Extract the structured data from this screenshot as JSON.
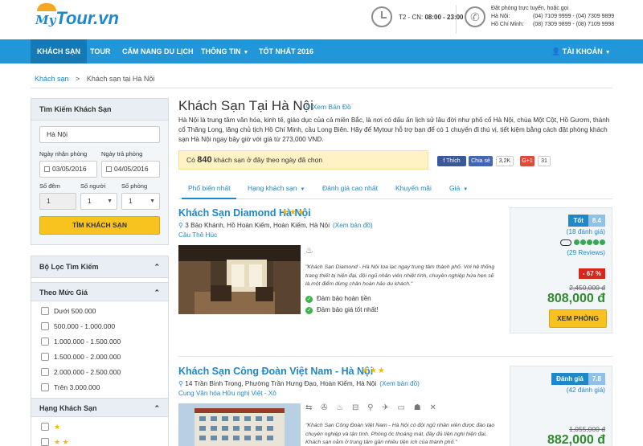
{
  "header": {
    "logo_prefix": "My",
    "logo_main": "Tour.vn",
    "hours_label": "T2 - CN:",
    "hours_value": "08:00 - 23:00",
    "phone_title": "Đặt phòng trực tuyến, hoặc gọi",
    "hanoi_label": "Hà Nội:",
    "hanoi_numbers": "(04) 7109 9999  -  (04) 7309 9899",
    "hcm_label": "Hồ Chí Minh:",
    "hcm_numbers": "(08) 7309 9899  -  (08) 7109 9998"
  },
  "nav": {
    "items": [
      "KHÁCH SẠN",
      "TOUR",
      "CẨM NANG DU LỊCH",
      "THÔNG TIN",
      "TỐT NHẤT 2016"
    ],
    "account": "TÀI KHOẢN"
  },
  "breadcrumb": {
    "root": "Khách sạn",
    "sep": ">",
    "current": "Khách sạn tại Hà Nội"
  },
  "search": {
    "title": "Tìm Kiếm Khách Sạn",
    "destination": "Hà Nội",
    "checkin_label": "Ngày nhận phòng",
    "checkout_label": "Ngày trả phòng",
    "checkin": "03/05/2016",
    "checkout": "04/05/2016",
    "nights_label": "Số đêm",
    "guests_label": "Số người",
    "rooms_label": "Số phòng",
    "nights": "1",
    "guests": "1",
    "rooms": "1",
    "button": "TÌM KHÁCH SẠN"
  },
  "filter": {
    "title": "Bộ Lọc Tìm Kiếm",
    "price_title": "Theo Mức Giá",
    "price_options": [
      "Dưới 500.000",
      "500.000 - 1.000.000",
      "1.000.000 - 1.500.000",
      "1.500.000 - 2.000.000",
      "2.000.000 - 2.500.000",
      "Trên 3.000.000"
    ],
    "class_title": "Hạng Khách Sạn",
    "class_stars": [
      "★",
      "★ ★"
    ]
  },
  "main": {
    "title": "Khách Sạn Tại Hà Nội",
    "map_link": "Xem Bản Đồ",
    "intro": "Hà Nội là trung tâm văn hóa, kinh tế, giáo dục của cả miền Bắc, là nơi có dấu ấn lịch sử lâu đời như phố cổ Hà Nội, chùa Một Cột, Hồ Gươm, thành cổ Thăng Long, lăng chủ tịch Hồ Chí Minh, cầu Long Biên. Hãy để Mytour hỗ trợ bạn để có 1 chuyến đi thú vị, tiết kiệm bằng cách đặt phòng khách sạn Hà Nội ngay bây giờ với giá từ 273,000 VND.",
    "count_prefix": "Có",
    "count": "840",
    "count_suffix": "khách sạn ở đây theo ngày đã chọn",
    "fb_like": "Thích",
    "fb_share": "Chia sẻ",
    "fb_count": "3,2K",
    "gplus": "G+1",
    "gplus_count": "31",
    "tabs": [
      "Phổ biến nhất",
      "Hạng khách sạn",
      "Đánh giá cao nhất",
      "Khuyến mãi",
      "Giá"
    ]
  },
  "hotels": [
    {
      "name": "Khách Sạn Diamond Hà Nội",
      "stars": "★★★",
      "address": "3 Bảo Khánh, Hồ Hoàn Kiếm, Hoàn Kiếm, Hà Nội",
      "map": "(Xem bản đồ)",
      "area": "Cầu Thê Húc",
      "amenities": "♨",
      "description": "\"Khách Sạn Diamond - Hà Nội tọa lạc ngay trung tâm thành phố. Với hệ thống trang thiết bị hiện đại, đội ngũ nhân viên nhiệt tình, chuyên nghiệp hứa hẹn sẽ là một điểm dừng chân hoàn hảo du khách.\"",
      "check1": "Đảm bảo hoàn tiền",
      "check2": "Đảm bảo giá tốt nhất!",
      "rating_word": "Tốt",
      "rating": "8.4",
      "rating_count": "(18 đánh giá)",
      "ta_reviews": "(29 Reviews)",
      "discount": "- 67 %",
      "old_price": "2,450,000 đ",
      "price": "808,000 đ",
      "button": "XEM PHÒNG"
    },
    {
      "name": "Khách Sạn Công Đoàn Việt Nam - Hà Nội",
      "stars": "★★★",
      "address": "14 Trần Bình Trọng, Phường Trần Hưng Đạo, Hoàn Kiếm, Hà Nội",
      "map": "(Xem bản đồ)",
      "area": "Cung Văn hóa Hữu nghị Việt - Xô",
      "amenities": "⇆ ✇ ♨ ⊟ ⚲ ✈ ▭ ☗ ✕",
      "description": "\"Khách Sạn Công Đoàn Việt Nam - Hà Nội có đội ngũ nhân viên được đào tạo chuyên nghiệp và tận tình. Phòng ốc thoáng mát, đầy đủ tiện nghi hiện đại. Khách sạn nằm ở trung tâm gần nhiều tiện ích của thành phố.\"",
      "rating_word": "Đánh giá",
      "rating": "7.8",
      "rating_count": "(42 đánh giá)",
      "old_price": "1,055,000 đ",
      "price": "882,000 đ"
    }
  ],
  "colors": {
    "brand": "#2196d9",
    "accent": "#f8c31e",
    "price": "#2e8b2e"
  }
}
